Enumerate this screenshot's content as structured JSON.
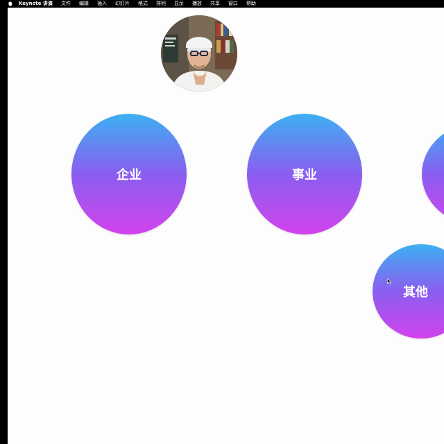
{
  "menubar": {
    "app_name": "Keynote 讲演",
    "items": [
      "文件",
      "编辑",
      "插入",
      "幻灯片",
      "格式",
      "排列",
      "显示",
      "播放",
      "共享",
      "窗口",
      "帮助"
    ]
  },
  "slide": {
    "bubbles": [
      {
        "label": "企业"
      },
      {
        "label": "事业"
      },
      {
        "label": ""
      },
      {
        "label": "其他"
      }
    ]
  },
  "colors": {
    "gradient_top": "#3cb0f2",
    "gradient_bottom": "#d243ec",
    "slide_background": "#fdfdfd",
    "menubar_background": "#000000"
  },
  "icons": {
    "apple": "apple-icon",
    "cursor": "mouse-cursor-icon"
  }
}
